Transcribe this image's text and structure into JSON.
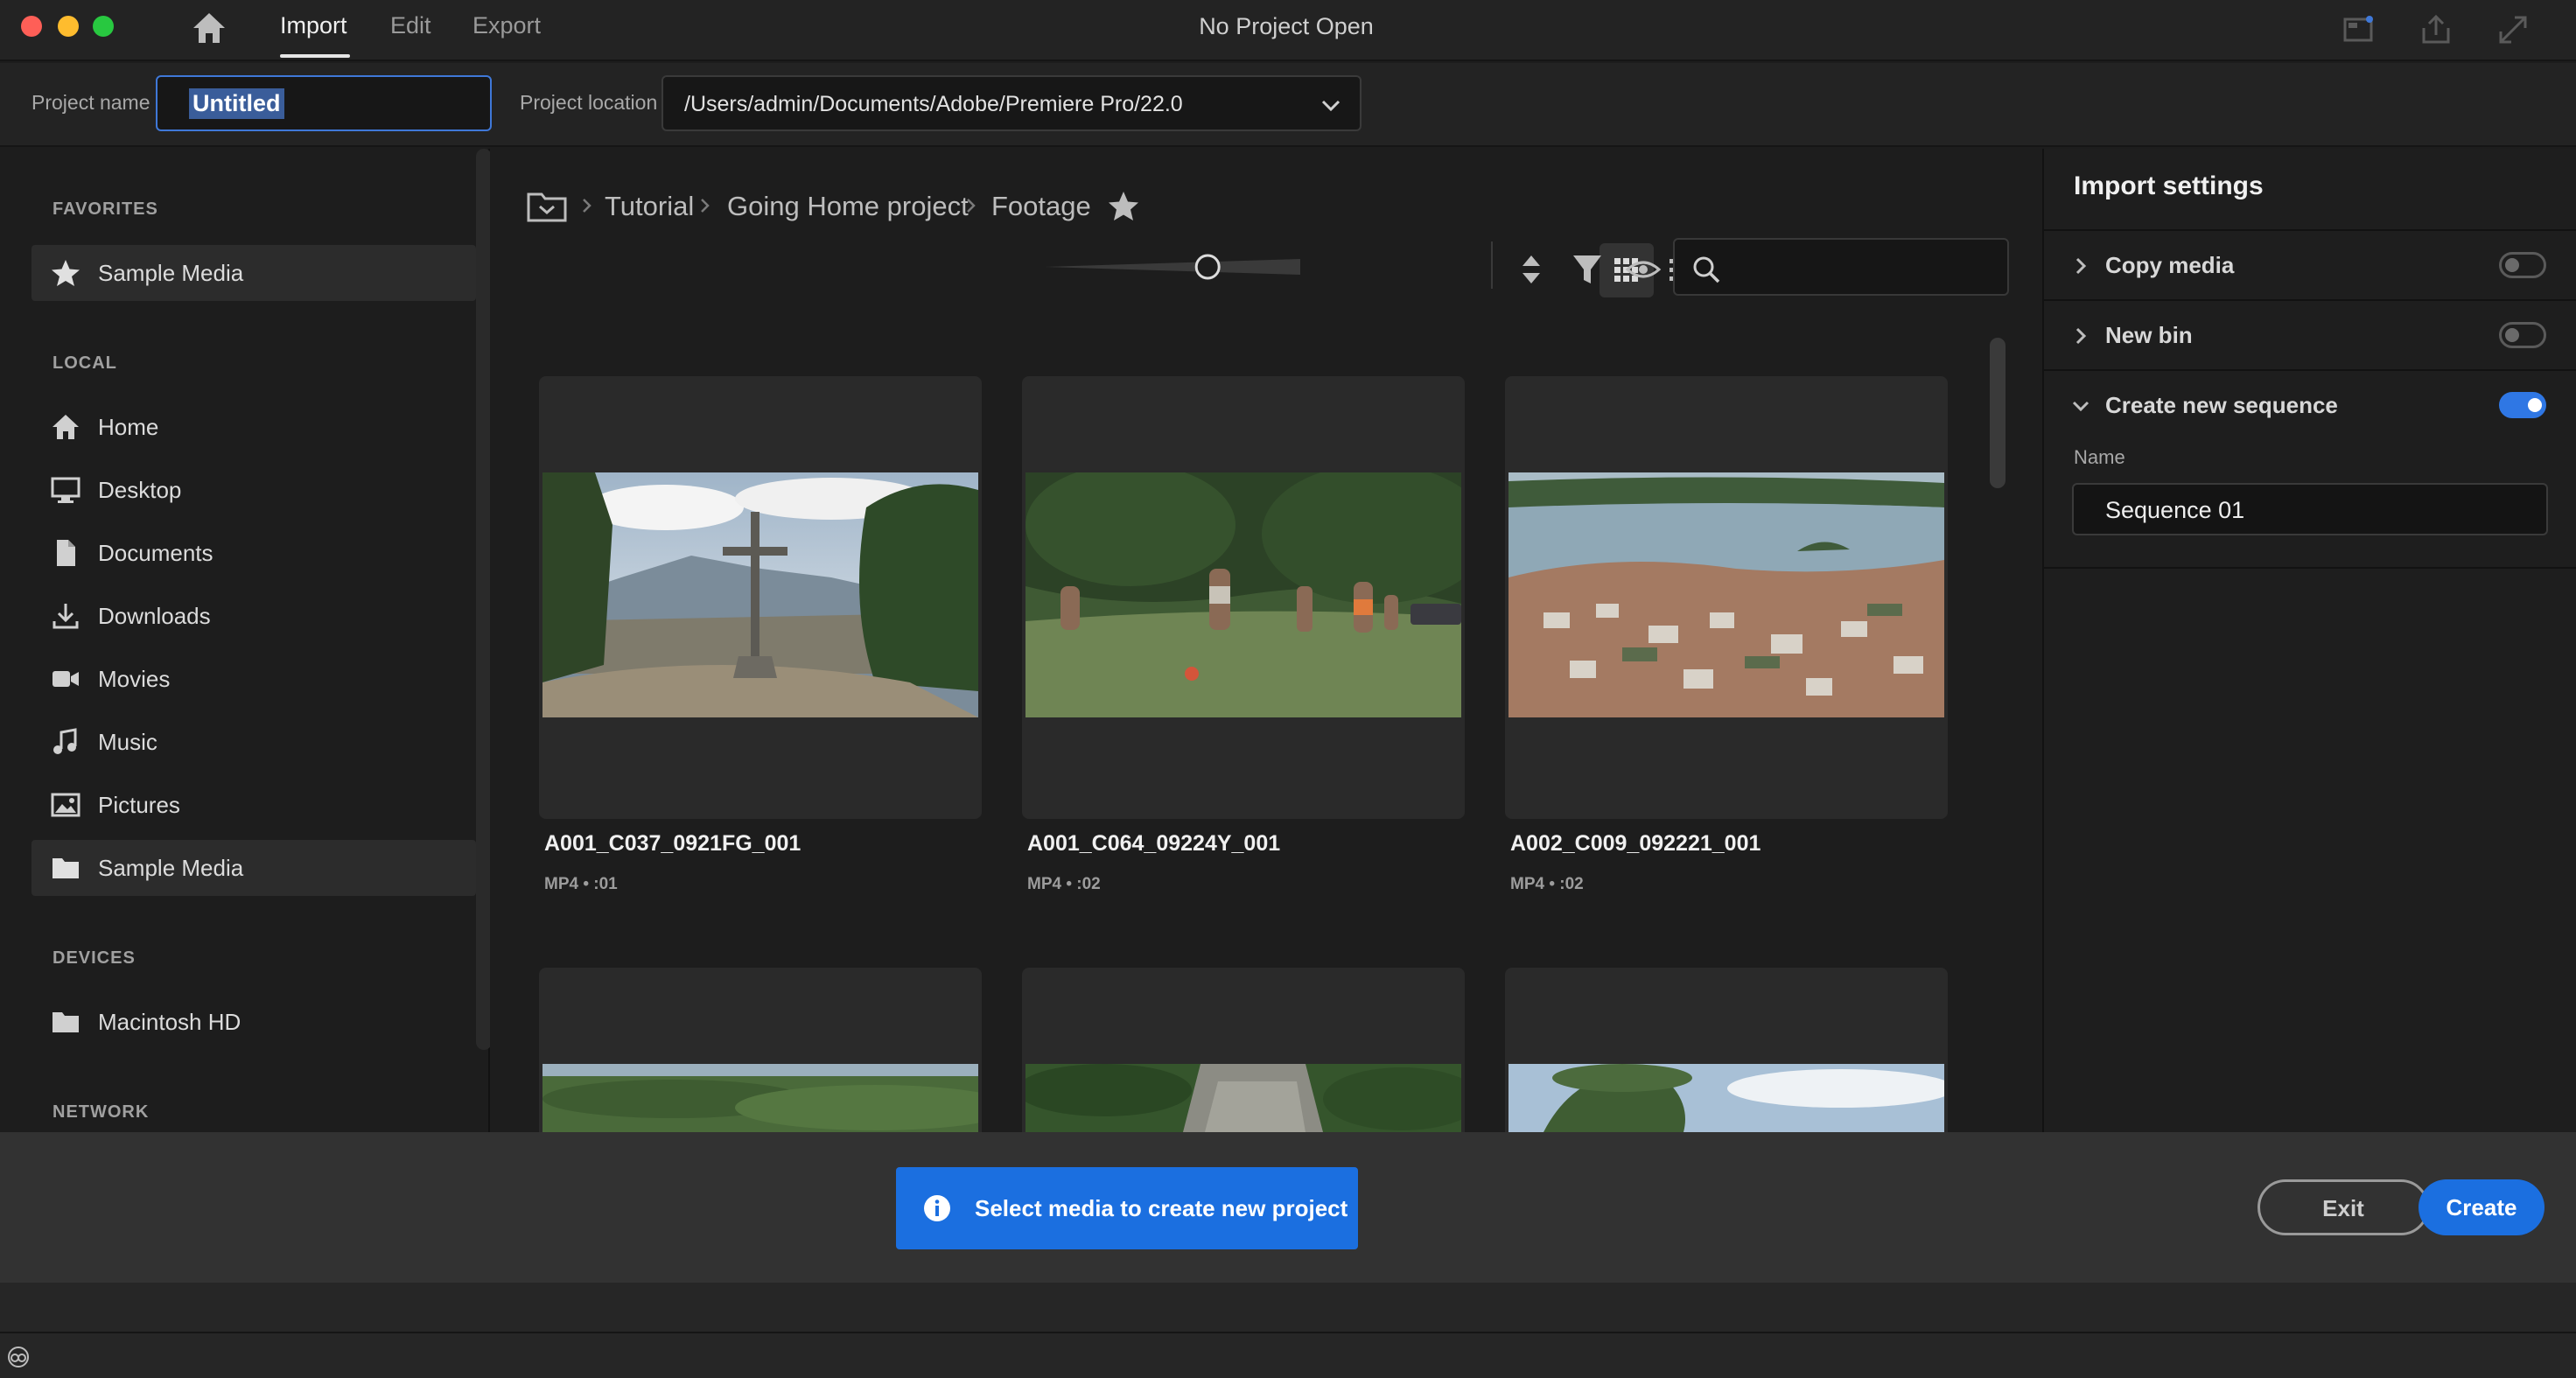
{
  "titlebar": {
    "tabs": [
      {
        "label": "Import",
        "active": true
      },
      {
        "label": "Edit",
        "active": false
      },
      {
        "label": "Export",
        "active": false
      }
    ],
    "window_title": "No Project Open",
    "icons": [
      "home-icon",
      "panel-layout-icon",
      "share-icon",
      "fullscreen-icon"
    ]
  },
  "project": {
    "name_label": "Project name",
    "name_value": "Untitled",
    "location_label": "Project location",
    "location_value": "/Users/admin/Documents/Adobe/Premiere Pro/22.0"
  },
  "sidebar": {
    "sections": {
      "favorites": "FAVORITES",
      "local": "LOCAL",
      "devices": "DEVICES",
      "network": "NETWORK"
    },
    "favorites": [
      {
        "label": "Sample Media",
        "icon": "star-icon",
        "selected": true
      }
    ],
    "local": [
      {
        "label": "Home",
        "icon": "home-icon"
      },
      {
        "label": "Desktop",
        "icon": "desktop-icon"
      },
      {
        "label": "Documents",
        "icon": "document-icon"
      },
      {
        "label": "Downloads",
        "icon": "download-icon"
      },
      {
        "label": "Movies",
        "icon": "movie-camera-icon"
      },
      {
        "label": "Music",
        "icon": "music-note-icon"
      },
      {
        "label": "Pictures",
        "icon": "picture-icon"
      },
      {
        "label": "Sample Media",
        "icon": "folder-icon",
        "selected": true
      }
    ],
    "devices": [
      {
        "label": "Macintosh HD",
        "icon": "folder-icon"
      }
    ]
  },
  "browser": {
    "breadcrumb": [
      "Tutorial",
      "Going Home project",
      "Footage"
    ],
    "thumbnail_zoom": 0.65,
    "view_mode": "grid",
    "search": {
      "value": "",
      "placeholder": ""
    },
    "items": [
      {
        "name": "A001_C037_0921FG_001",
        "meta": "MP4 • :01"
      },
      {
        "name": "A001_C064_09224Y_001",
        "meta": "MP4 • :02"
      },
      {
        "name": "A002_C009_092221_001",
        "meta": "MP4 • :02"
      }
    ]
  },
  "import_settings": {
    "title": "Import settings",
    "rows": [
      {
        "label": "Copy media",
        "enabled": false,
        "expanded": false
      },
      {
        "label": "New bin",
        "enabled": false,
        "expanded": false
      },
      {
        "label": "Create new sequence",
        "enabled": true,
        "expanded": true
      }
    ],
    "sequence_name_label": "Name",
    "sequence_name_value": "Sequence 01"
  },
  "actions": {
    "hint": "Select media to create new project",
    "exit_label": "Exit",
    "create_label": "Create"
  },
  "colors": {
    "accent": "#1b6fe0",
    "background": "#1d1d1d"
  }
}
